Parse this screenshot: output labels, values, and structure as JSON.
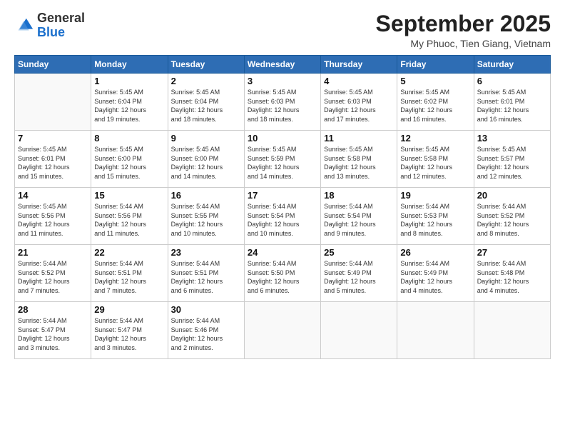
{
  "logo": {
    "general": "General",
    "blue": "Blue"
  },
  "header": {
    "month": "September 2025",
    "location": "My Phuoc, Tien Giang, Vietnam"
  },
  "weekdays": [
    "Sunday",
    "Monday",
    "Tuesday",
    "Wednesday",
    "Thursday",
    "Friday",
    "Saturday"
  ],
  "weeks": [
    [
      {
        "day": "",
        "info": ""
      },
      {
        "day": "1",
        "info": "Sunrise: 5:45 AM\nSunset: 6:04 PM\nDaylight: 12 hours\nand 19 minutes."
      },
      {
        "day": "2",
        "info": "Sunrise: 5:45 AM\nSunset: 6:04 PM\nDaylight: 12 hours\nand 18 minutes."
      },
      {
        "day": "3",
        "info": "Sunrise: 5:45 AM\nSunset: 6:03 PM\nDaylight: 12 hours\nand 18 minutes."
      },
      {
        "day": "4",
        "info": "Sunrise: 5:45 AM\nSunset: 6:03 PM\nDaylight: 12 hours\nand 17 minutes."
      },
      {
        "day": "5",
        "info": "Sunrise: 5:45 AM\nSunset: 6:02 PM\nDaylight: 12 hours\nand 16 minutes."
      },
      {
        "day": "6",
        "info": "Sunrise: 5:45 AM\nSunset: 6:01 PM\nDaylight: 12 hours\nand 16 minutes."
      }
    ],
    [
      {
        "day": "7",
        "info": "Sunrise: 5:45 AM\nSunset: 6:01 PM\nDaylight: 12 hours\nand 15 minutes."
      },
      {
        "day": "8",
        "info": "Sunrise: 5:45 AM\nSunset: 6:00 PM\nDaylight: 12 hours\nand 15 minutes."
      },
      {
        "day": "9",
        "info": "Sunrise: 5:45 AM\nSunset: 6:00 PM\nDaylight: 12 hours\nand 14 minutes."
      },
      {
        "day": "10",
        "info": "Sunrise: 5:45 AM\nSunset: 5:59 PM\nDaylight: 12 hours\nand 14 minutes."
      },
      {
        "day": "11",
        "info": "Sunrise: 5:45 AM\nSunset: 5:58 PM\nDaylight: 12 hours\nand 13 minutes."
      },
      {
        "day": "12",
        "info": "Sunrise: 5:45 AM\nSunset: 5:58 PM\nDaylight: 12 hours\nand 12 minutes."
      },
      {
        "day": "13",
        "info": "Sunrise: 5:45 AM\nSunset: 5:57 PM\nDaylight: 12 hours\nand 12 minutes."
      }
    ],
    [
      {
        "day": "14",
        "info": "Sunrise: 5:45 AM\nSunset: 5:56 PM\nDaylight: 12 hours\nand 11 minutes."
      },
      {
        "day": "15",
        "info": "Sunrise: 5:44 AM\nSunset: 5:56 PM\nDaylight: 12 hours\nand 11 minutes."
      },
      {
        "day": "16",
        "info": "Sunrise: 5:44 AM\nSunset: 5:55 PM\nDaylight: 12 hours\nand 10 minutes."
      },
      {
        "day": "17",
        "info": "Sunrise: 5:44 AM\nSunset: 5:54 PM\nDaylight: 12 hours\nand 10 minutes."
      },
      {
        "day": "18",
        "info": "Sunrise: 5:44 AM\nSunset: 5:54 PM\nDaylight: 12 hours\nand 9 minutes."
      },
      {
        "day": "19",
        "info": "Sunrise: 5:44 AM\nSunset: 5:53 PM\nDaylight: 12 hours\nand 8 minutes."
      },
      {
        "day": "20",
        "info": "Sunrise: 5:44 AM\nSunset: 5:52 PM\nDaylight: 12 hours\nand 8 minutes."
      }
    ],
    [
      {
        "day": "21",
        "info": "Sunrise: 5:44 AM\nSunset: 5:52 PM\nDaylight: 12 hours\nand 7 minutes."
      },
      {
        "day": "22",
        "info": "Sunrise: 5:44 AM\nSunset: 5:51 PM\nDaylight: 12 hours\nand 7 minutes."
      },
      {
        "day": "23",
        "info": "Sunrise: 5:44 AM\nSunset: 5:51 PM\nDaylight: 12 hours\nand 6 minutes."
      },
      {
        "day": "24",
        "info": "Sunrise: 5:44 AM\nSunset: 5:50 PM\nDaylight: 12 hours\nand 6 minutes."
      },
      {
        "day": "25",
        "info": "Sunrise: 5:44 AM\nSunset: 5:49 PM\nDaylight: 12 hours\nand 5 minutes."
      },
      {
        "day": "26",
        "info": "Sunrise: 5:44 AM\nSunset: 5:49 PM\nDaylight: 12 hours\nand 4 minutes."
      },
      {
        "day": "27",
        "info": "Sunrise: 5:44 AM\nSunset: 5:48 PM\nDaylight: 12 hours\nand 4 minutes."
      }
    ],
    [
      {
        "day": "28",
        "info": "Sunrise: 5:44 AM\nSunset: 5:47 PM\nDaylight: 12 hours\nand 3 minutes."
      },
      {
        "day": "29",
        "info": "Sunrise: 5:44 AM\nSunset: 5:47 PM\nDaylight: 12 hours\nand 3 minutes."
      },
      {
        "day": "30",
        "info": "Sunrise: 5:44 AM\nSunset: 5:46 PM\nDaylight: 12 hours\nand 2 minutes."
      },
      {
        "day": "",
        "info": ""
      },
      {
        "day": "",
        "info": ""
      },
      {
        "day": "",
        "info": ""
      },
      {
        "day": "",
        "info": ""
      }
    ]
  ]
}
